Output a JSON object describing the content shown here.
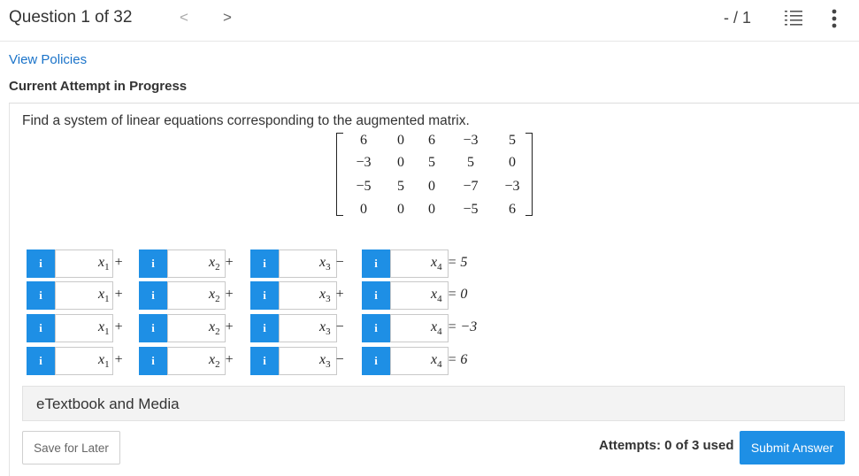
{
  "header": {
    "question_label": "Question 1 of 32",
    "prev_glyph": "<",
    "next_glyph": ">",
    "score": "- / 1",
    "icons": [
      "list-icon",
      "more-vertical-icon"
    ]
  },
  "links": {
    "view_policies": "View Policies"
  },
  "attempt_heading": "Current Attempt in Progress",
  "question": {
    "prompt": "Find a system of linear equations corresponding to the augmented matrix.",
    "matrix": [
      [
        "6",
        "0",
        "6",
        "−3",
        "5"
      ],
      [
        "−3",
        "0",
        "5",
        "5",
        "0"
      ],
      [
        "−5",
        "5",
        "0",
        "−7",
        "−3"
      ],
      [
        "0",
        "0",
        "0",
        "−5",
        "6"
      ]
    ]
  },
  "equations": {
    "input_icon_label": "i",
    "rows": [
      {
        "t1": "x",
        "t1_sub": "1",
        "t1_op": "+",
        "t2": "x",
        "t2_sub": "2",
        "t2_op": "+",
        "t3": "x",
        "t3_sub": "3",
        "t3_op": "−",
        "t4": "x",
        "t4_sub": "4",
        "rhs": "= 5"
      },
      {
        "t1": "x",
        "t1_sub": "1",
        "t1_op": "+",
        "t2": "x",
        "t2_sub": "2",
        "t2_op": "+",
        "t3": "x",
        "t3_sub": "3",
        "t3_op": "+",
        "t4": "x",
        "t4_sub": "4",
        "rhs": "= 0"
      },
      {
        "t1": "x",
        "t1_sub": "1",
        "t1_op": "+",
        "t2": "x",
        "t2_sub": "2",
        "t2_op": "+",
        "t3": "x",
        "t3_sub": "3",
        "t3_op": "−",
        "t4": "x",
        "t4_sub": "4",
        "rhs": "= −3"
      },
      {
        "t1": "x",
        "t1_sub": "1",
        "t1_op": "+",
        "t2": "x",
        "t2_sub": "2",
        "t2_op": "+",
        "t3": "x",
        "t3_sub": "3",
        "t3_op": "−",
        "t4": "x",
        "t4_sub": "4",
        "rhs": "= 6"
      }
    ],
    "field_values": [
      "",
      "",
      "",
      ""
    ]
  },
  "etextbook_label": "eTextbook and Media",
  "footer": {
    "save_label": "Save for Later",
    "attempts_text": "Attempts: 0 of 3 used",
    "submit_label": "Submit Answer"
  },
  "colors": {
    "accent": "#1e8fe5",
    "link": "#1a73c9"
  }
}
